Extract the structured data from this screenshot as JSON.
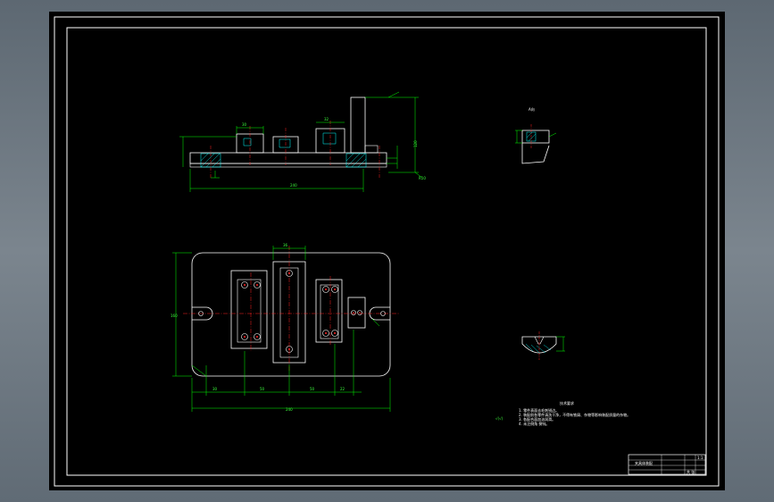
{
  "colors": {
    "background": "#000000",
    "frame": "#ffffff",
    "dimension": "#00ff00",
    "centerline": "#ff2020",
    "hatch": "#00ffff",
    "part": "#ffffff"
  },
  "drawing": {
    "tech_req_title": "技术要求",
    "tech_req_items": [
      "1. 零件表面去毛刺锐边。",
      "2. 装配前各零件清洗干净，不得有铁屑、杂物等影响装配质量的杂物。",
      "3. 各配合面加油润滑。",
      "4. 未注倒角 倒钝。"
    ],
    "roughness_symbol": "√(√)",
    "overall_width_dim": "240",
    "side_height_dim": "160",
    "detail_label": "A向",
    "title_block": {
      "part_name": "夹具体装配",
      "scale": "1:1",
      "sheet": "共 张"
    }
  }
}
